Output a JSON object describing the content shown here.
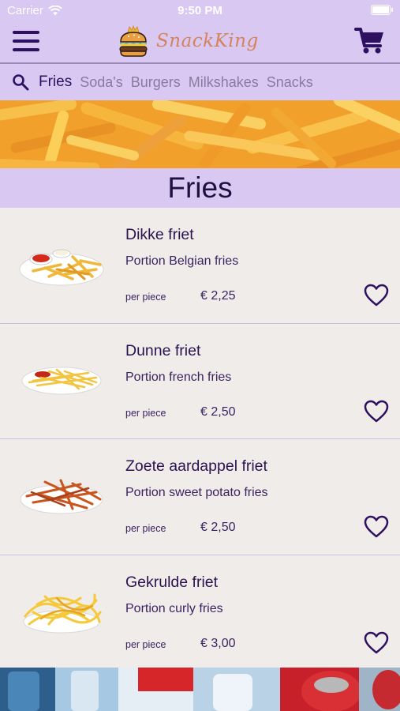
{
  "status_bar": {
    "carrier": "Carrier",
    "time": "9:50 PM"
  },
  "app_bar": {
    "logo_text": "SnackKing",
    "menu_icon": "hamburger-menu-icon",
    "cart_icon": "shopping-cart-icon"
  },
  "categories": [
    {
      "label": "Fries",
      "active": true
    },
    {
      "label": "Soda's",
      "active": false
    },
    {
      "label": "Burgers",
      "active": false
    },
    {
      "label": "Milkshakes",
      "active": false
    },
    {
      "label": "Snacks",
      "active": false
    }
  ],
  "section": {
    "title": "Fries"
  },
  "products": [
    {
      "name": "Dikke friet",
      "description": "Portion Belgian fries",
      "unit": "per piece",
      "price": "€ 2,25"
    },
    {
      "name": "Dunne friet",
      "description": "Portion french fries",
      "unit": "per piece",
      "price": "€ 2,50"
    },
    {
      "name": "Zoete aardappel friet",
      "description": "Portion sweet potato fries",
      "unit": "per piece",
      "price": "€ 2,50"
    },
    {
      "name": "Gekrulde friet",
      "description": "Portion curly fries",
      "unit": "per piece",
      "price": "€ 3,00"
    }
  ],
  "colors": {
    "lavender": "#d8c8f2",
    "dark_purple": "#2e1060",
    "logo_orange": "#d4835a",
    "background": "#efecea"
  }
}
